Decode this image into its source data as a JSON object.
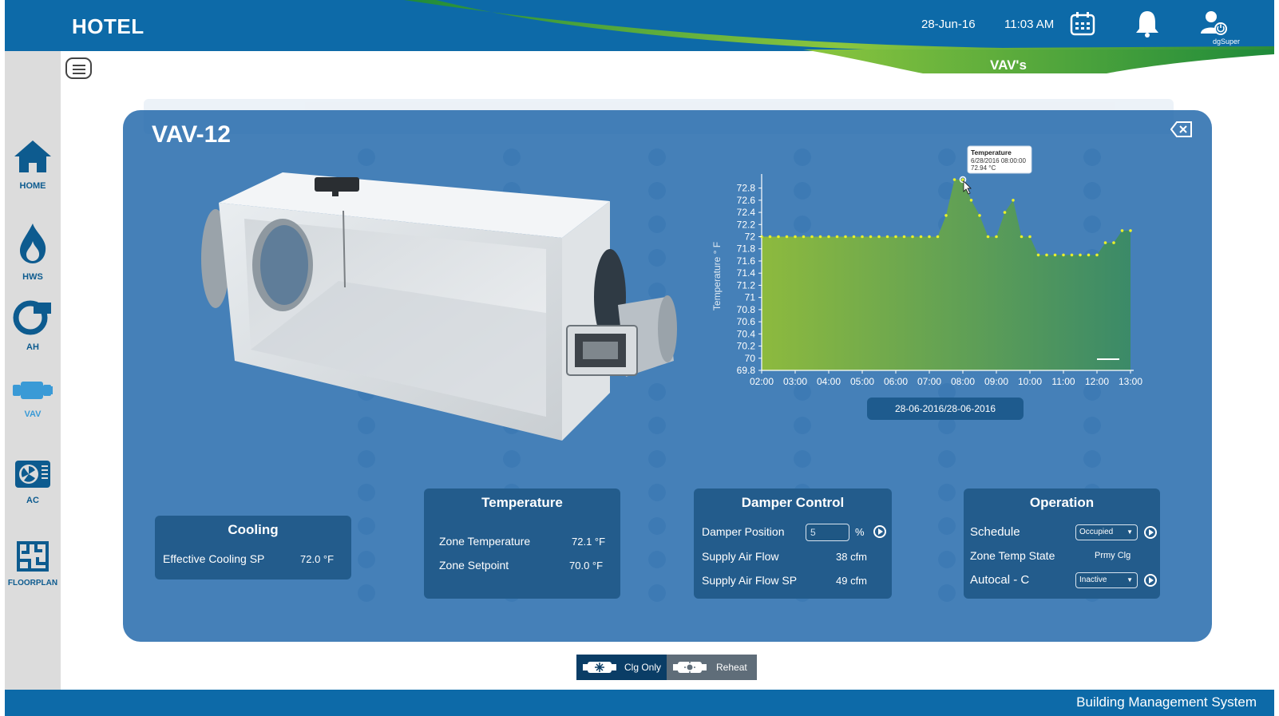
{
  "header": {
    "app_title": "HOTEL",
    "date": "28-Jun-16",
    "time": "11:03 AM",
    "user_name": "dgSuper",
    "section_title": "VAV's"
  },
  "sidebar": {
    "items": [
      {
        "label": "HOME",
        "icon": "home-icon"
      },
      {
        "label": "HWS",
        "icon": "flame-icon"
      },
      {
        "label": "AH",
        "icon": "fan-icon"
      },
      {
        "label": "VAV",
        "icon": "vav-icon"
      },
      {
        "label": "AC",
        "icon": "ac-unit-icon"
      },
      {
        "label": "FLOORPLAN",
        "icon": "floorplan-icon"
      }
    ]
  },
  "modal": {
    "title": "VAV-12"
  },
  "chart_data": {
    "type": "area",
    "ylabel": "Temperature ° F",
    "xlabel": "",
    "x": [
      "02:00",
      "03:00",
      "04:00",
      "05:00",
      "06:00",
      "07:00",
      "08:00",
      "09:00",
      "10:00",
      "11:00",
      "12:00",
      "13:00"
    ],
    "yticks": [
      69.8,
      70,
      70.2,
      70.4,
      70.6,
      70.8,
      71,
      71.2,
      71.4,
      71.6,
      71.8,
      72,
      72.2,
      72.4,
      72.6,
      72.8
    ],
    "ylim": [
      69.8,
      72.9
    ],
    "series": [
      {
        "name": "Temperature",
        "points": [
          [
            2.0,
            72.0
          ],
          [
            2.25,
            72.0
          ],
          [
            2.5,
            72.0
          ],
          [
            2.75,
            72.0
          ],
          [
            3.0,
            72.0
          ],
          [
            3.25,
            72.0
          ],
          [
            3.5,
            72.0
          ],
          [
            3.75,
            72.0
          ],
          [
            4.0,
            72.0
          ],
          [
            4.25,
            72.0
          ],
          [
            4.5,
            72.0
          ],
          [
            4.75,
            72.0
          ],
          [
            5.0,
            72.0
          ],
          [
            5.25,
            72.0
          ],
          [
            5.5,
            72.0
          ],
          [
            5.75,
            72.0
          ],
          [
            6.0,
            72.0
          ],
          [
            6.25,
            72.0
          ],
          [
            6.5,
            72.0
          ],
          [
            6.75,
            72.0
          ],
          [
            7.0,
            72.0
          ],
          [
            7.25,
            72.0
          ],
          [
            7.5,
            72.35
          ],
          [
            7.75,
            72.94
          ],
          [
            8.0,
            72.94
          ],
          [
            8.25,
            72.6
          ],
          [
            8.5,
            72.35
          ],
          [
            8.75,
            72.0
          ],
          [
            9.0,
            72.0
          ],
          [
            9.25,
            72.4
          ],
          [
            9.5,
            72.6
          ],
          [
            9.75,
            72.0
          ],
          [
            10.0,
            72.0
          ],
          [
            10.25,
            71.7
          ],
          [
            10.5,
            71.7
          ],
          [
            10.75,
            71.7
          ],
          [
            11.0,
            71.7
          ],
          [
            11.25,
            71.7
          ],
          [
            11.5,
            71.7
          ],
          [
            11.75,
            71.7
          ],
          [
            12.0,
            71.7
          ],
          [
            12.25,
            71.9
          ],
          [
            12.5,
            71.9
          ],
          [
            12.75,
            72.1
          ],
          [
            13.0,
            72.1
          ]
        ]
      }
    ],
    "fill_colors": [
      "#8dba3e",
      "#3b8a68"
    ],
    "point_color": "#e8ef2a",
    "tooltip": {
      "title": "Temperature",
      "date": "6/28/2016 08:00:00",
      "value": "72.94 °C"
    }
  },
  "date_range": "28-06-2016/28-06-2016",
  "panels": {
    "cooling": {
      "title": "Cooling",
      "effective_cooling_sp_label": "Effective Cooling SP",
      "effective_cooling_sp_value": "72.0 °F"
    },
    "temperature": {
      "title": "Temperature",
      "zone_temp_label": "Zone Temperature",
      "zone_temp_value": "72.1 °F",
      "zone_setpoint_label": "Zone Setpoint",
      "zone_setpoint_value": "70.0 °F"
    },
    "damper": {
      "title": "Damper Control",
      "position_label": "Damper Position",
      "position_value": "5",
      "position_unit": "%",
      "supply_air_flow_label": "Supply Air Flow",
      "supply_air_flow_value": "38 cfm",
      "supply_air_flow_sp_label": "Supply Air Flow SP",
      "supply_air_flow_sp_value": "49 cfm"
    },
    "operation": {
      "title": "Operation",
      "schedule_label": "Schedule",
      "schedule_value": "Occupied",
      "zone_temp_state_label": "Zone Temp State",
      "zone_temp_state_value": "Prmy Clg",
      "autocal_label": "Autocal - C",
      "autocal_value": "Inactive"
    }
  },
  "mode_toggle": {
    "clg_only_label": "Clg Only",
    "reheat_label": "Reheat",
    "active": "Clg Only"
  },
  "footer": {
    "text": "Building Management System"
  },
  "colors": {
    "header_blue": "#0d6aa8",
    "accent_green": "#8dba3e",
    "modal_blue": "#1c64a8",
    "panel_blue": "#235c8c"
  }
}
